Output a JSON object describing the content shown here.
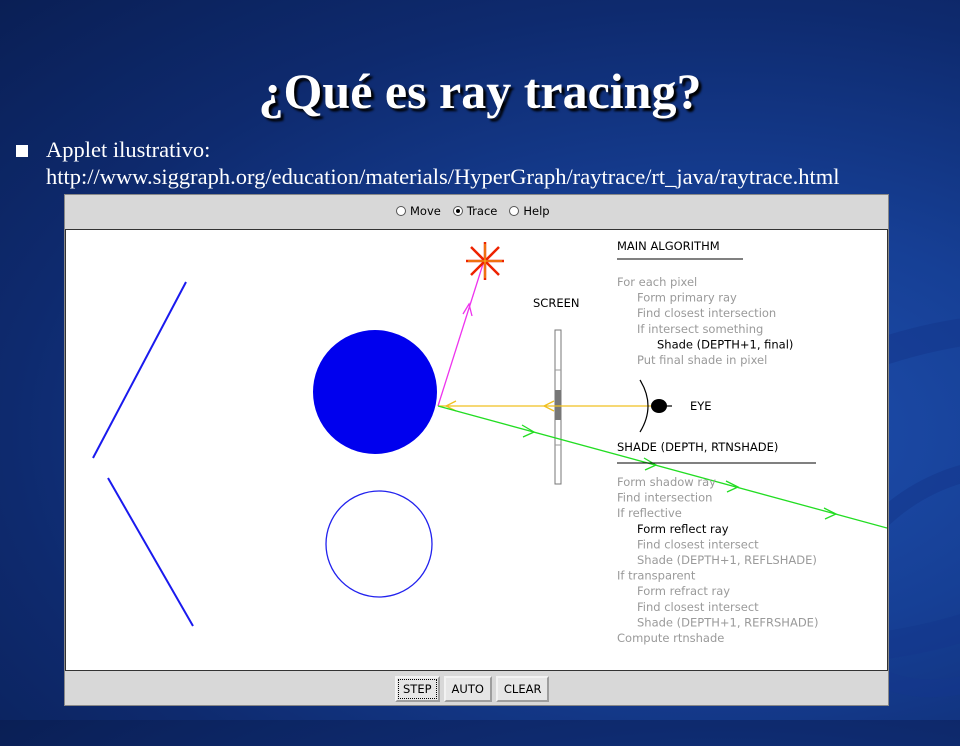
{
  "slide": {
    "title": "¿Qué es ray tracing?",
    "bullet_line1": "Applet ilustrativo:",
    "bullet_line2": "http://www.siggraph.org/education/materials/HyperGraph/raytrace/rt_java/raytrace.html"
  },
  "applet": {
    "modes": [
      {
        "label": "Move",
        "selected": false
      },
      {
        "label": "Trace",
        "selected": true
      },
      {
        "label": "Help",
        "selected": false
      }
    ],
    "buttons": {
      "step": "STEP",
      "auto": "AUTO",
      "clear": "CLEAR"
    },
    "scene": {
      "screen_label": "SCREEN",
      "eye_label": "EYE"
    },
    "main_algorithm": {
      "heading": "MAIN ALGORITHM",
      "lines": [
        {
          "text": "For each pixel",
          "indent": 0,
          "highlight": false
        },
        {
          "text": "Form primary ray",
          "indent": 1,
          "highlight": false
        },
        {
          "text": "Find closest intersection",
          "indent": 1,
          "highlight": false
        },
        {
          "text": "If intersect something",
          "indent": 1,
          "highlight": false
        },
        {
          "text": "Shade (DEPTH+1, final)",
          "indent": 2,
          "highlight": true
        },
        {
          "text": "Put final shade in pixel",
          "indent": 1,
          "highlight": false
        }
      ]
    },
    "shade_algorithm": {
      "heading": "SHADE (DEPTH, RTNSHADE)",
      "lines": [
        {
          "text": "Form shadow ray",
          "indent": 0,
          "highlight": false
        },
        {
          "text": "Find intersection",
          "indent": 0,
          "highlight": false
        },
        {
          "text": "If reflective",
          "indent": 0,
          "highlight": false
        },
        {
          "text": "Form reflect ray",
          "indent": 1,
          "highlight": true
        },
        {
          "text": "Find closest intersect",
          "indent": 1,
          "highlight": false
        },
        {
          "text": "Shade (DEPTH+1, REFLSHADE)",
          "indent": 1,
          "highlight": false
        },
        {
          "text": "If transparent",
          "indent": 0,
          "highlight": false
        },
        {
          "text": "Form refract ray",
          "indent": 1,
          "highlight": false
        },
        {
          "text": "Find closest intersect",
          "indent": 1,
          "highlight": false
        },
        {
          "text": "Shade (DEPTH+1, REFRSHADE)",
          "indent": 1,
          "highlight": false
        },
        {
          "text": "Compute rtnshade",
          "indent": 0,
          "highlight": false
        }
      ]
    },
    "colors": {
      "sphere": "#0000ee",
      "shadow_ray": "#ee33ee",
      "primary_ray": "#f0c020",
      "reflect_ray": "#22dd22",
      "light": "#ee2200"
    }
  }
}
